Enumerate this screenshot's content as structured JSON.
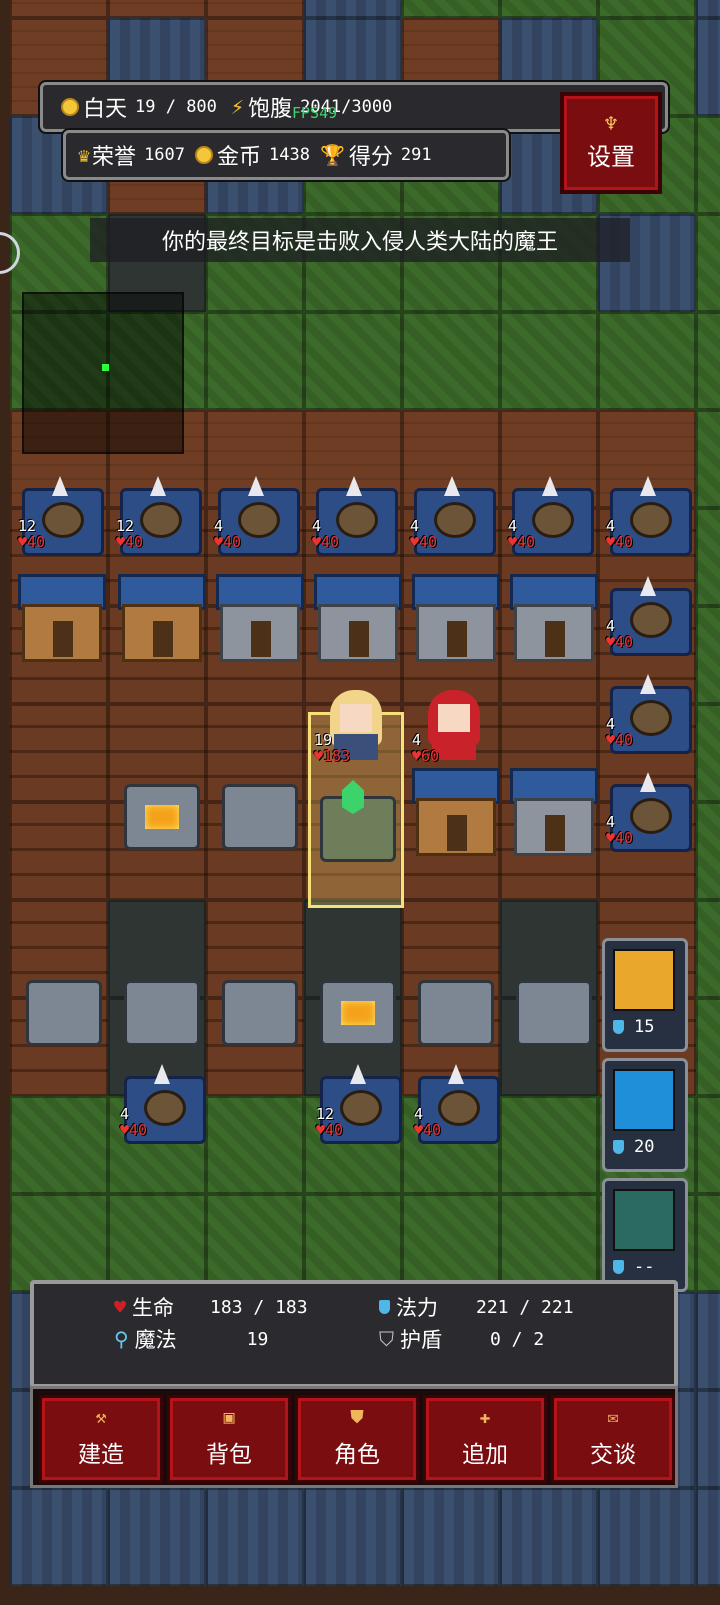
{
  "hud": {
    "day_label": "白天",
    "day_value": "19 / 800",
    "hunger_label": "饱腹",
    "hunger_value": "2041/3000",
    "fps_text": "FPS49",
    "honor_label": "荣誉",
    "honor_value": "1607",
    "gold_label": "金币",
    "gold_value": "1438",
    "score_label": "得分",
    "score_value": "291",
    "settings_label": "设置"
  },
  "goal_text": "你的最终目标是击败入侵人类大陆的魔王",
  "units": {
    "ballista_top": [
      {
        "atk": "12",
        "hp": "40"
      },
      {
        "atk": "12",
        "hp": "40"
      },
      {
        "atk": "4",
        "hp": "40"
      },
      {
        "atk": "4",
        "hp": "40"
      },
      {
        "atk": "4",
        "hp": "40"
      },
      {
        "atk": "4",
        "hp": "40"
      },
      {
        "atk": "4",
        "hp": "40"
      }
    ],
    "ballista_right": [
      {
        "atk": "4",
        "hp": "40"
      },
      {
        "atk": "4",
        "hp": "40"
      },
      {
        "atk": "4",
        "hp": "40"
      }
    ],
    "ballista_bottom": [
      {
        "atk": "4",
        "hp": "40"
      },
      {
        "atk": "12",
        "hp": "40"
      },
      {
        "atk": "4",
        "hp": "40"
      }
    ],
    "hero": {
      "atk": "19",
      "hp": "183"
    },
    "companion": {
      "atk": "4",
      "hp": "60"
    }
  },
  "skills": [
    {
      "icon": "holy-light-icon",
      "cost": "15",
      "color": "#e9a72b"
    },
    {
      "icon": "lightning-icon",
      "cost": "20",
      "color": "#1e8fd8"
    },
    {
      "icon": "shield-rune-icon",
      "cost": "--",
      "color": "#2a6a63"
    }
  ],
  "stats": {
    "life_label": "生命",
    "life_value": "183 / 183",
    "mana_label": "法力",
    "mana_value": "221 / 221",
    "magic_label": "魔法",
    "magic_value": "19",
    "shield_label": "护盾",
    "shield_value": "0 / 2"
  },
  "actions": {
    "build": "建造",
    "backpack": "背包",
    "character": "角色",
    "add": "追加",
    "talk": "交谈"
  },
  "colors": {
    "button_red": "#7a0d10",
    "gold": "#f5c12b",
    "fps_green": "#3ed46a"
  }
}
